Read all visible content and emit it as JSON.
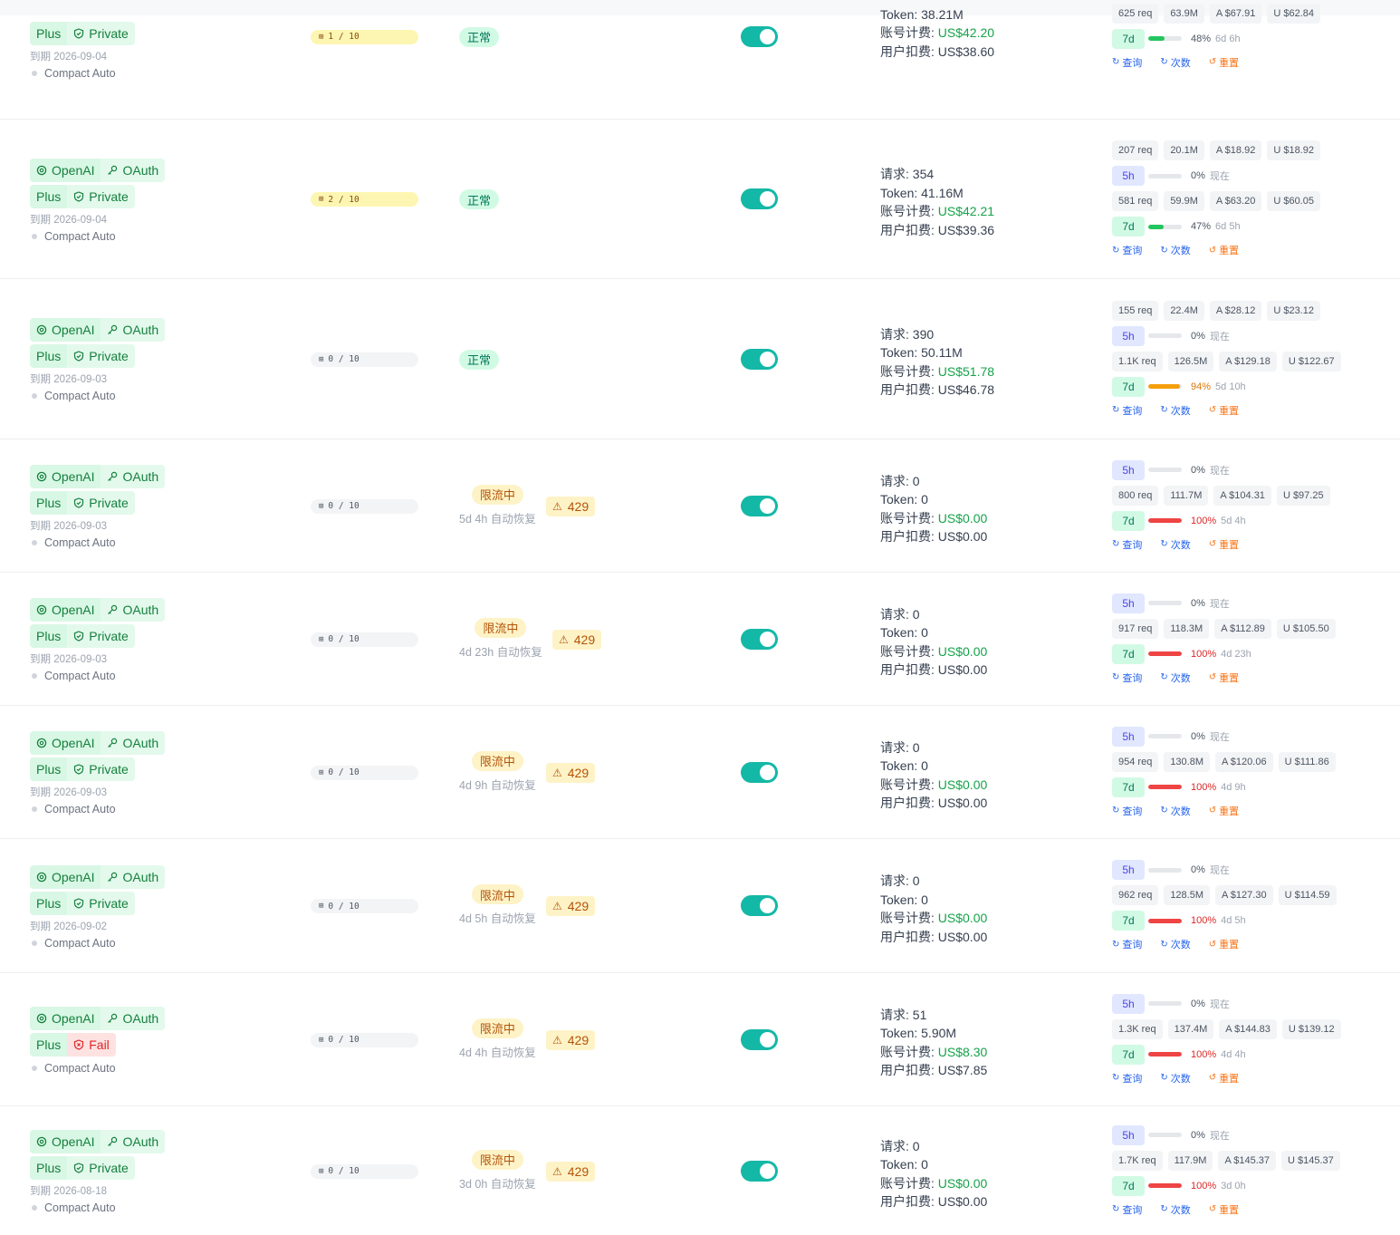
{
  "icons": {
    "openai": "openai-icon",
    "oauth": "key-icon",
    "private": "shield-check-icon",
    "fail": "shield-x-icon",
    "concurrency": "grid-icon",
    "warning": "warning-icon",
    "query": "refresh-icon",
    "count": "refresh-icon",
    "reset": "reset-icon"
  },
  "colors": {
    "toggle_on": "#14b8a6",
    "bar_low": "#22c55e",
    "bar_warn": "#f59e0b",
    "bar_full": "#ef4444",
    "money": "#16a34a"
  },
  "labels": {
    "openai": "OpenAI",
    "oauth": "OAuth",
    "plus": "Plus",
    "private": "Private",
    "fail": "Fail",
    "mode": "Compact Auto",
    "expiry_prefix": "到期",
    "ok": "正常",
    "limited": "限流中",
    "auto_recover": "自动恢复",
    "requests": "请求: ",
    "token": "Token: ",
    "account_cost": "账号计费: ",
    "user_cost": "用户扣费: ",
    "query": "查询",
    "count": "次数",
    "reset": "重置",
    "win5h": "5h",
    "win7d": "7d",
    "code": "429"
  },
  "rows": [
    {
      "showPlatform": false,
      "tierStatus": "Private",
      "expiry": "2026-09-04",
      "concurrency": "1 / 10",
      "concActive": true,
      "status": "ok",
      "recover": "",
      "showCode": false,
      "requests": null,
      "token": "38.21M",
      "account_cost": "US$42.20",
      "user_cost": "US$38.60",
      "window5h": null,
      "window7d": {
        "req": "625 req",
        "tok": "63.9M",
        "a": "A $67.91",
        "u": "U $62.84",
        "pct": 48,
        "pctText": "48%",
        "eta": "6d 6h"
      }
    },
    {
      "showPlatform": true,
      "tierStatus": "Private",
      "expiry": "2026-09-04",
      "concurrency": "2 / 10",
      "concActive": true,
      "status": "ok",
      "recover": "",
      "showCode": false,
      "requests": "354",
      "token": "41.16M",
      "account_cost": "US$42.21",
      "user_cost": "US$39.36",
      "window5h": {
        "req": "207 req",
        "tok": "20.1M",
        "a": "A $18.92",
        "u": "U $18.92",
        "pct": 0,
        "pctText": "0%",
        "eta": "现在"
      },
      "window7d": {
        "req": "581 req",
        "tok": "59.9M",
        "a": "A $63.20",
        "u": "U $60.05",
        "pct": 47,
        "pctText": "47%",
        "eta": "6d 5h"
      }
    },
    {
      "showPlatform": true,
      "tierStatus": "Private",
      "expiry": "2026-09-03",
      "concurrency": "0 / 10",
      "concActive": false,
      "status": "ok",
      "recover": "",
      "showCode": false,
      "requests": "390",
      "token": "50.11M",
      "account_cost": "US$51.78",
      "user_cost": "US$46.78",
      "window5h": {
        "req": "155 req",
        "tok": "22.4M",
        "a": "A $28.12",
        "u": "U $23.12",
        "pct": 0,
        "pctText": "0%",
        "eta": "现在"
      },
      "window7d": {
        "req": "1.1K req",
        "tok": "126.5M",
        "a": "A $129.18",
        "u": "U $122.67",
        "pct": 94,
        "pctText": "94%",
        "eta": "5d 10h"
      }
    },
    {
      "showPlatform": true,
      "tierStatus": "Private",
      "expiry": "2026-09-03",
      "concurrency": "0 / 10",
      "concActive": false,
      "status": "limited",
      "recover": "5d 4h",
      "showCode": true,
      "requests": "0",
      "token": "0",
      "account_cost": "US$0.00",
      "user_cost": "US$0.00",
      "window5h": {
        "req": "",
        "tok": "",
        "a": "",
        "u": "",
        "pct": 0,
        "pctText": "0%",
        "eta": "现在"
      },
      "window7d": {
        "req": "800 req",
        "tok": "111.7M",
        "a": "A $104.31",
        "u": "U $97.25",
        "pct": 100,
        "pctText": "100%",
        "eta": "5d 4h"
      }
    },
    {
      "showPlatform": true,
      "tierStatus": "Private",
      "expiry": "2026-09-03",
      "concurrency": "0 / 10",
      "concActive": false,
      "status": "limited",
      "recover": "4d 23h",
      "showCode": true,
      "requests": "0",
      "token": "0",
      "account_cost": "US$0.00",
      "user_cost": "US$0.00",
      "window5h": {
        "req": "",
        "tok": "",
        "a": "",
        "u": "",
        "pct": 0,
        "pctText": "0%",
        "eta": "现在"
      },
      "window7d": {
        "req": "917 req",
        "tok": "118.3M",
        "a": "A $112.89",
        "u": "U $105.50",
        "pct": 100,
        "pctText": "100%",
        "eta": "4d 23h"
      }
    },
    {
      "showPlatform": true,
      "tierStatus": "Private",
      "expiry": "2026-09-03",
      "concurrency": "0 / 10",
      "concActive": false,
      "status": "limited",
      "recover": "4d 9h",
      "showCode": true,
      "requests": "0",
      "token": "0",
      "account_cost": "US$0.00",
      "user_cost": "US$0.00",
      "window5h": {
        "req": "",
        "tok": "",
        "a": "",
        "u": "",
        "pct": 0,
        "pctText": "0%",
        "eta": "现在"
      },
      "window7d": {
        "req": "954 req",
        "tok": "130.8M",
        "a": "A $120.06",
        "u": "U $111.86",
        "pct": 100,
        "pctText": "100%",
        "eta": "4d 9h"
      }
    },
    {
      "showPlatform": true,
      "tierStatus": "Private",
      "expiry": "2026-09-02",
      "concurrency": "0 / 10",
      "concActive": false,
      "status": "limited",
      "recover": "4d 5h",
      "showCode": true,
      "requests": "0",
      "token": "0",
      "account_cost": "US$0.00",
      "user_cost": "US$0.00",
      "window5h": {
        "req": "",
        "tok": "",
        "a": "",
        "u": "",
        "pct": 0,
        "pctText": "0%",
        "eta": "现在"
      },
      "window7d": {
        "req": "962 req",
        "tok": "128.5M",
        "a": "A $127.30",
        "u": "U $114.59",
        "pct": 100,
        "pctText": "100%",
        "eta": "4d 5h"
      }
    },
    {
      "showPlatform": true,
      "tierStatus": "Fail",
      "expiry": "",
      "concurrency": "0 / 10",
      "concActive": false,
      "status": "limited",
      "recover": "4d 4h",
      "showCode": true,
      "requests": "51",
      "token": "5.90M",
      "account_cost": "US$8.30",
      "user_cost": "US$7.85",
      "window5h": {
        "req": "",
        "tok": "",
        "a": "",
        "u": "",
        "pct": 0,
        "pctText": "0%",
        "eta": "现在"
      },
      "window7d": {
        "req": "1.3K req",
        "tok": "137.4M",
        "a": "A $144.83",
        "u": "U $139.12",
        "pct": 100,
        "pctText": "100%",
        "eta": "4d 4h"
      }
    },
    {
      "showPlatform": true,
      "tierStatus": "Private",
      "expiry": "2026-08-18",
      "concurrency": "0 / 10",
      "concActive": false,
      "status": "limited",
      "recover": "3d 0h",
      "showCode": true,
      "requests": "0",
      "token": "0",
      "account_cost": "US$0.00",
      "user_cost": "US$0.00",
      "window5h": {
        "req": "",
        "tok": "",
        "a": "",
        "u": "",
        "pct": 0,
        "pctText": "0%",
        "eta": "现在"
      },
      "window7d": {
        "req": "1.7K req",
        "tok": "117.9M",
        "a": "A $145.37",
        "u": "U $145.37",
        "pct": 100,
        "pctText": "100%",
        "eta": "3d 0h"
      }
    }
  ]
}
